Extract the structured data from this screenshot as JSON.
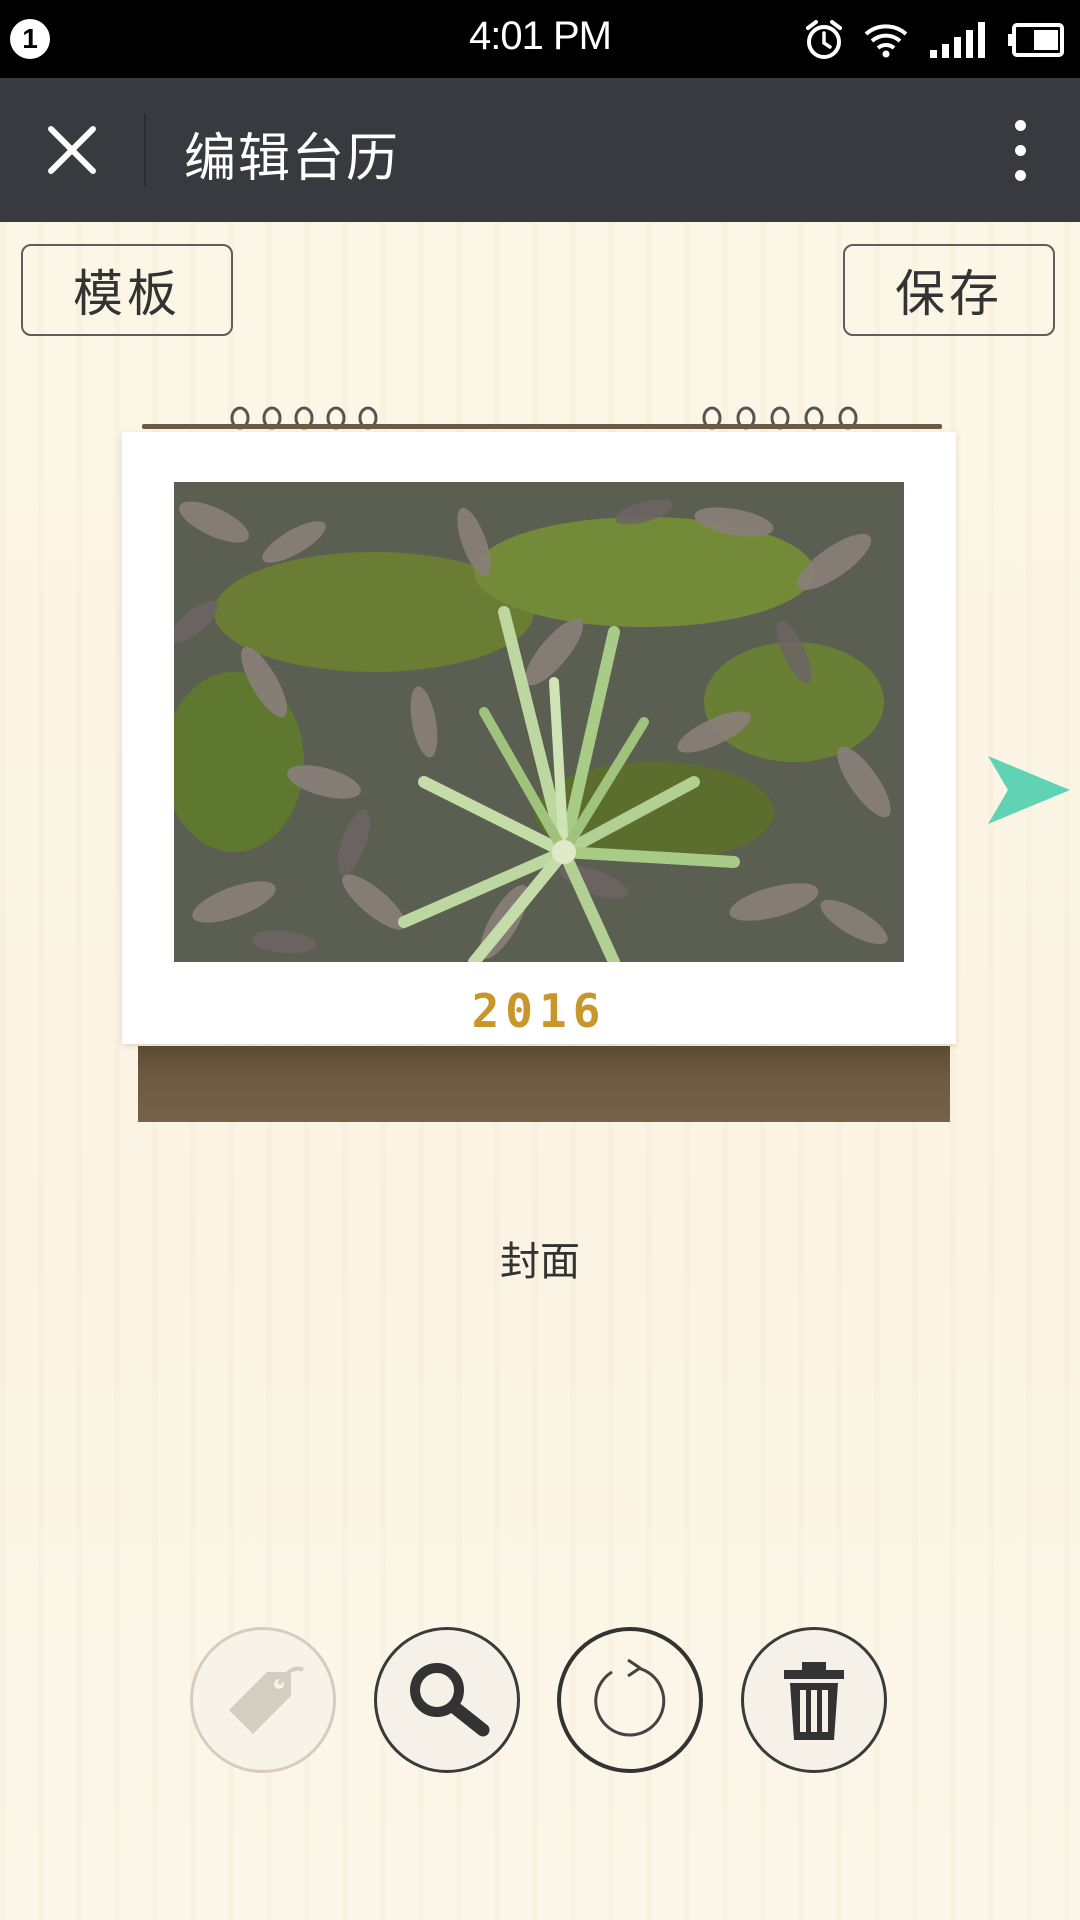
{
  "status_bar": {
    "notification_count": "1",
    "time": "4:01 PM",
    "icons": [
      "alarm-icon",
      "wifi-icon",
      "signal-icon",
      "battery-icon"
    ]
  },
  "app_bar": {
    "title": "编辑台历",
    "close_icon": "close-icon",
    "more_icon": "more-vertical-icon"
  },
  "toolbar": {
    "template_label": "模板",
    "save_label": "保存"
  },
  "calendar": {
    "year": "2016",
    "page_label": "封面",
    "next_icon": "next-arrow-icon",
    "accent_color": "#5fd3b4"
  },
  "tools": [
    {
      "name": "tag-icon",
      "enabled": false
    },
    {
      "name": "zoom-icon",
      "enabled": true
    },
    {
      "name": "rotate-icon",
      "enabled": true
    },
    {
      "name": "delete-icon",
      "enabled": true
    }
  ]
}
